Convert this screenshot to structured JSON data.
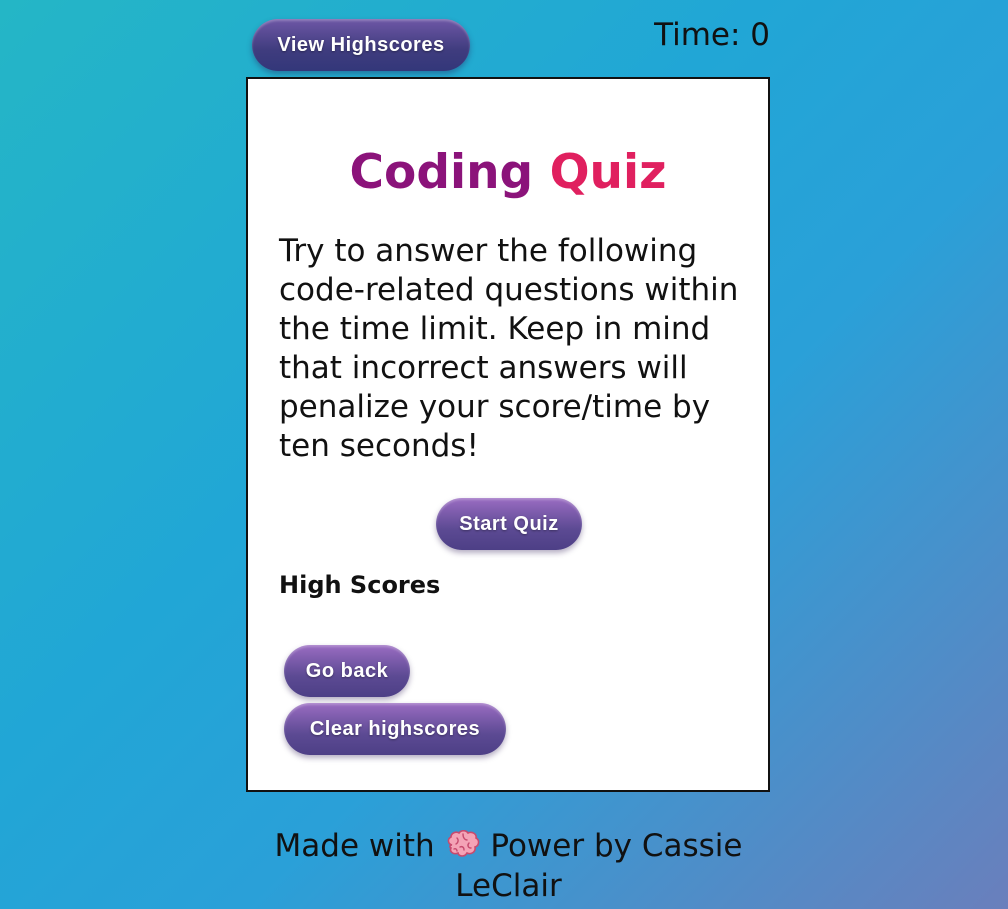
{
  "header": {
    "view_highscores_label": "View Highscores",
    "timer_label": "Time:",
    "timer_value": "0"
  },
  "quiz": {
    "title_part1": "Coding",
    "title_part2": "Quiz",
    "intro": "Try to answer the following code-related questions within the time limit. Keep in mind that incorrect answers will penalize your score/time by ten seconds!",
    "start_label": "Start Quiz"
  },
  "highscores": {
    "heading": "High Scores",
    "entries": [],
    "go_back_label": "Go back",
    "clear_label": "Clear highscores"
  },
  "footer": {
    "made_with": "Made with",
    "icon": "brain-icon",
    "power_by": "Power by Cassie LeClair"
  },
  "colors": {
    "title_primary": "#8b137a",
    "title_accent": "#e0205f",
    "button_top": "#9a6cc2",
    "button_bottom": "#4d3f86"
  }
}
